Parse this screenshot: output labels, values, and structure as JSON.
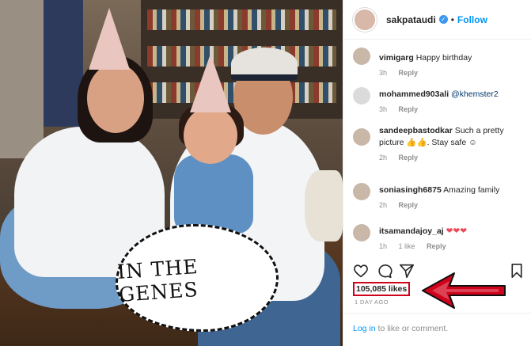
{
  "photo": {
    "caption_art": "IN THE GENES"
  },
  "header": {
    "username": "sakpataudi",
    "verified_glyph": "✓",
    "separator": "•",
    "follow_label": "Follow"
  },
  "comments": [
    {
      "user": "vimigarg",
      "text": "Happy birthday",
      "time": "3h",
      "likes": "",
      "reply": "Reply",
      "avatar": "user-avatar"
    },
    {
      "user": "mohammed903ali",
      "text": "",
      "mention": "@khemster2",
      "time": "3h",
      "likes": "",
      "reply": "Reply",
      "avatar": "blank-avatar"
    },
    {
      "user": "sandeepbastodkar",
      "text": "Such a pretty picture 👍👍. Stay safe ☺",
      "time": "2h",
      "likes": "",
      "reply": "Reply",
      "avatar": "user-avatar"
    },
    {
      "user": "soniasingh6875",
      "text": "Amazing family",
      "time": "2h",
      "likes": "",
      "reply": "Reply",
      "avatar": "user-avatar"
    },
    {
      "user": "itsamandajoy_aj",
      "text": "",
      "hearts": "❤❤❤",
      "time": "1h",
      "likes": "1 like",
      "reply": "Reply",
      "avatar": "user-avatar"
    }
  ],
  "actions": {
    "likes": "105,085 likes",
    "timestamp": "1 DAY AGO"
  },
  "footer": {
    "login_link": "Log in",
    "login_rest": " to like or comment."
  },
  "colors": {
    "accent": "#0095f6",
    "highlight": "#d0021b"
  }
}
